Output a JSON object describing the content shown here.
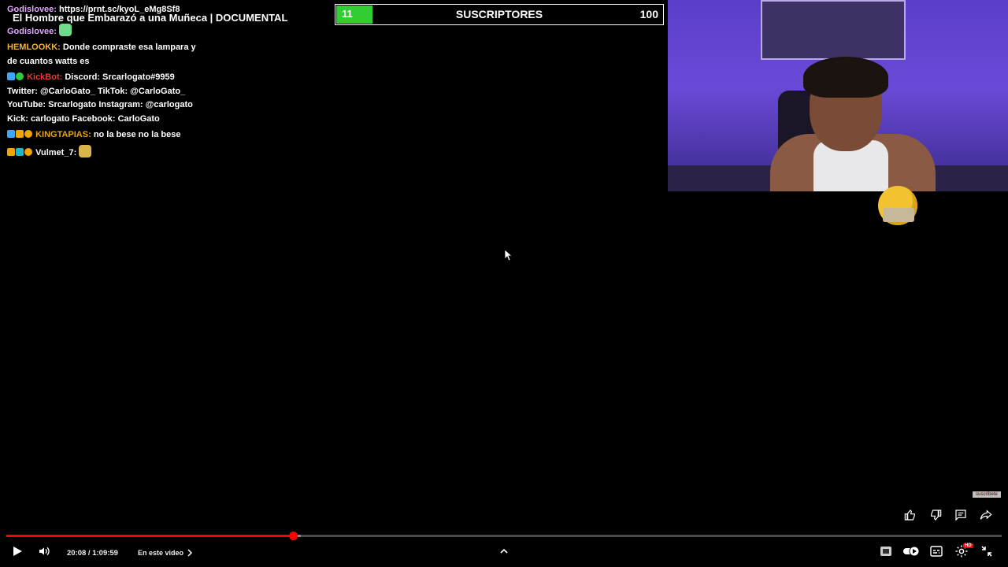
{
  "overlay": {
    "title": "El Hombre que Embarazó a una Muñeca | DOCUMENTAL",
    "chat": [
      {
        "user": "Godislovee:",
        "user_color": "#e0a8ff",
        "text": "https://prnt.sc/kyoL_eMg8Sf8"
      },
      {
        "user": "Godislovee:",
        "user_color": "#e0a8ff",
        "text": ""
      },
      {
        "user": "HEMLOOKK:",
        "user_color": "#f2b33d",
        "text": "Donde compraste esa lampara y de cuantos watts es"
      },
      {
        "user": "KickBot:",
        "user_color": "#e53935",
        "text": "Discord: Srcarlogato#9959 Twitter: @CarloGato_ TikTok: @CarloGato_ YouTube: Srcarlogato Instagram: @carlogato Kick: carlogato Facebook: CarloGato"
      },
      {
        "user": "KINGTAPIAS:",
        "user_color": "#f0a500",
        "text": "no la bese no la bese"
      },
      {
        "user": "Vulmet_7:",
        "user_color": "#ffffff",
        "text": ""
      }
    ]
  },
  "subgoal": {
    "current": "11",
    "label": "SUSCRIPTORES",
    "goal": "100",
    "progress_fraction": 0.11,
    "fill_color": "#32cd32"
  },
  "watermark": "suscríbete",
  "player": {
    "time": "20:08 / 1:09:59",
    "chapter_label": "En este video",
    "played_fraction": 0.288,
    "buffered_fraction": 0.296,
    "accent": "#ff0000",
    "icons": {
      "play": "play-icon",
      "volume": "volume-icon",
      "chapter_chevron": "chevron-right-icon",
      "expand": "chevron-up-icon",
      "cc_alt": "iq-icon",
      "autoplay": "autoplay-toggle-icon",
      "subtitles": "subtitles-icon",
      "settings": "settings-icon",
      "settings_badge": "HD",
      "exit_fullscreen": "exit-fullscreen-icon",
      "like": "like-icon",
      "dislike": "dislike-icon",
      "comments": "comments-icon",
      "share": "share-icon"
    }
  }
}
